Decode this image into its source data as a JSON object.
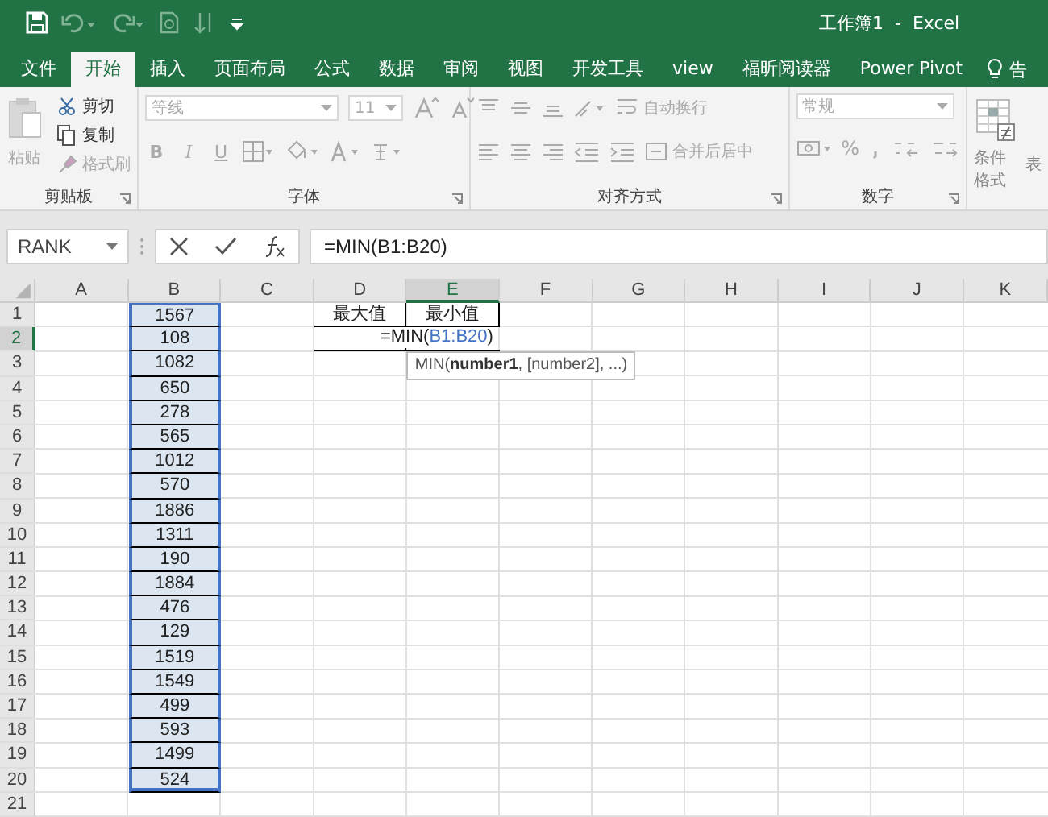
{
  "window": {
    "title": "工作簿1  -  Excel"
  },
  "tabs": [
    {
      "label": "文件",
      "selected": false
    },
    {
      "label": "开始",
      "selected": true
    },
    {
      "label": "插入",
      "selected": false
    },
    {
      "label": "页面布局",
      "selected": false
    },
    {
      "label": "公式",
      "selected": false
    },
    {
      "label": "数据",
      "selected": false
    },
    {
      "label": "审阅",
      "selected": false
    },
    {
      "label": "视图",
      "selected": false
    },
    {
      "label": "开发工具",
      "selected": false
    },
    {
      "label": "view",
      "selected": false
    },
    {
      "label": "福昕阅读器",
      "selected": false
    },
    {
      "label": "Power Pivot",
      "selected": false
    }
  ],
  "tell_me": {
    "label": "告"
  },
  "ribbon": {
    "groups": [
      {
        "kind": "clipboard",
        "label": "剪贴板",
        "paste": {
          "label": "粘贴",
          "disabled": true
        },
        "items": [
          {
            "label": "剪切",
            "disabled": false
          },
          {
            "label": "复制",
            "disabled": false
          },
          {
            "label": "格式刷",
            "disabled": true
          }
        ]
      },
      {
        "kind": "font",
        "label": "字体",
        "font": {
          "value": "等线",
          "disabled": true
        },
        "size": {
          "value": "11",
          "disabled": true
        },
        "styles": [
          "B",
          "I",
          "U"
        ]
      },
      {
        "kind": "align",
        "label": "对齐方式",
        "items": [
          {
            "label": "自动换行",
            "disabled": true
          },
          {
            "label": "合并后居中",
            "disabled": true
          }
        ]
      },
      {
        "kind": "number",
        "label": "数字",
        "format": {
          "value": "常规",
          "disabled": true
        },
        "percent": "%"
      },
      {
        "kind": "styles",
        "label": "条件格式",
        "extra": "表"
      }
    ]
  },
  "formula_bar": {
    "name_box": "RANK",
    "formula": "=MIN(B1:B20)"
  },
  "sheet": {
    "columns": [
      {
        "label": "A",
        "selected": false
      },
      {
        "label": "B",
        "selected": false
      },
      {
        "label": "C",
        "selected": false
      },
      {
        "label": "D",
        "selected": false
      },
      {
        "label": "E",
        "selected": true
      },
      {
        "label": "F",
        "selected": false
      },
      {
        "label": "G",
        "selected": false
      },
      {
        "label": "H",
        "selected": false
      },
      {
        "label": "I",
        "selected": false
      },
      {
        "label": "J",
        "selected": false
      },
      {
        "label": "K",
        "selected": false
      }
    ],
    "rows": [
      {
        "number": "1",
        "selected": false,
        "cells": {
          "B": {
            "value": "1567",
            "referenced": true,
            "bordered": true
          },
          "D": {
            "value": "最大值",
            "bordered": true
          },
          "E": {
            "value": "最小值",
            "bordered": true
          }
        }
      },
      {
        "number": "2",
        "selected": true,
        "cells": {
          "B": {
            "value": "108",
            "referenced": true,
            "bordered": true
          },
          "D": {
            "bordered": true
          },
          "E": {
            "kind": "formula",
            "prefix": "=MIN(",
            "reference": "B1:B20",
            "suffix": ")",
            "bordered": true
          }
        }
      },
      {
        "number": "3",
        "selected": false,
        "cells": {
          "B": {
            "value": "1082",
            "referenced": true,
            "bordered": true
          }
        }
      },
      {
        "number": "4",
        "selected": false,
        "cells": {
          "B": {
            "value": "650",
            "referenced": true,
            "bordered": true
          }
        }
      },
      {
        "number": "5",
        "selected": false,
        "cells": {
          "B": {
            "value": "278",
            "referenced": true,
            "bordered": true
          }
        }
      },
      {
        "number": "6",
        "selected": false,
        "cells": {
          "B": {
            "value": "565",
            "referenced": true,
            "bordered": true
          }
        }
      },
      {
        "number": "7",
        "selected": false,
        "cells": {
          "B": {
            "value": "1012",
            "referenced": true,
            "bordered": true
          }
        }
      },
      {
        "number": "8",
        "selected": false,
        "cells": {
          "B": {
            "value": "570",
            "referenced": true,
            "bordered": true
          }
        }
      },
      {
        "number": "9",
        "selected": false,
        "cells": {
          "B": {
            "value": "1886",
            "referenced": true,
            "bordered": true
          }
        }
      },
      {
        "number": "10",
        "selected": false,
        "cells": {
          "B": {
            "value": "1311",
            "referenced": true,
            "bordered": true
          }
        }
      },
      {
        "number": "11",
        "selected": false,
        "cells": {
          "B": {
            "value": "190",
            "referenced": true,
            "bordered": true
          }
        }
      },
      {
        "number": "12",
        "selected": false,
        "cells": {
          "B": {
            "value": "1884",
            "referenced": true,
            "bordered": true
          }
        }
      },
      {
        "number": "13",
        "selected": false,
        "cells": {
          "B": {
            "value": "476",
            "referenced": true,
            "bordered": true
          }
        }
      },
      {
        "number": "14",
        "selected": false,
        "cells": {
          "B": {
            "value": "129",
            "referenced": true,
            "bordered": true
          }
        }
      },
      {
        "number": "15",
        "selected": false,
        "cells": {
          "B": {
            "value": "1519",
            "referenced": true,
            "bordered": true
          }
        }
      },
      {
        "number": "16",
        "selected": false,
        "cells": {
          "B": {
            "value": "1549",
            "referenced": true,
            "bordered": true
          }
        }
      },
      {
        "number": "17",
        "selected": false,
        "cells": {
          "B": {
            "value": "499",
            "referenced": true,
            "bordered": true
          }
        }
      },
      {
        "number": "18",
        "selected": false,
        "cells": {
          "B": {
            "value": "593",
            "referenced": true,
            "bordered": true
          }
        }
      },
      {
        "number": "19",
        "selected": false,
        "cells": {
          "B": {
            "value": "1499",
            "referenced": true,
            "bordered": true
          }
        }
      },
      {
        "number": "20",
        "selected": false,
        "cells": {
          "B": {
            "value": "524",
            "referenced": true,
            "bordered": true
          }
        }
      },
      {
        "number": "21",
        "selected": false,
        "cells": {}
      }
    ],
    "tooltip": "MIN(**number1**, [number2], ...)"
  }
}
